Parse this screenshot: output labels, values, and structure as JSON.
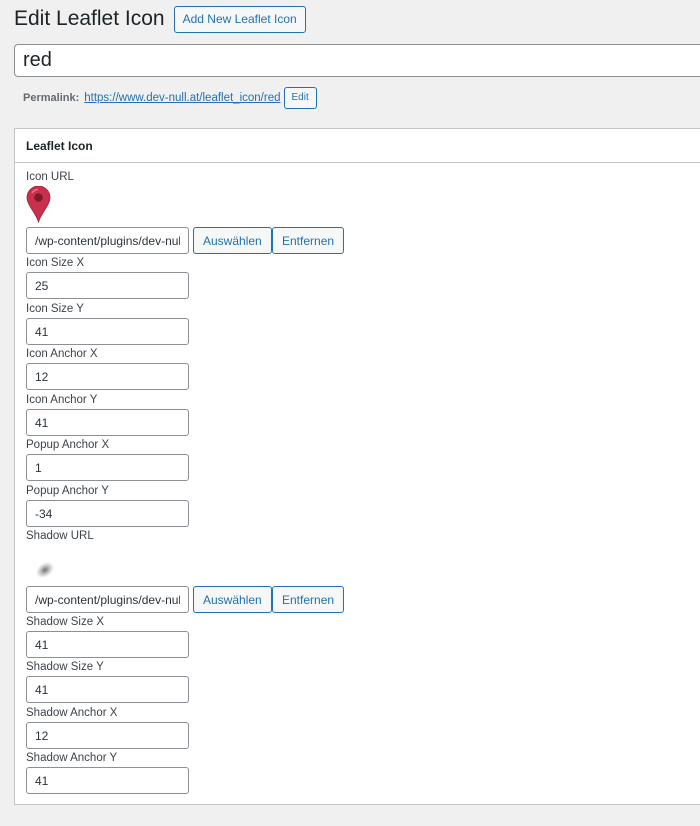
{
  "header": {
    "title": "Edit Leaflet Icon",
    "add_new_label": "Add New Leaflet Icon"
  },
  "post": {
    "title_value": "red",
    "permalink_label": "Permalink:",
    "permalink_url": "https://www.dev-null.at/leaflet_icon/red",
    "edit_label": "Edit"
  },
  "metabox": {
    "title": "Leaflet Icon",
    "icon_url": {
      "label": "Icon URL",
      "value": "/wp-content/plugins/dev-null-leaflet/icons/marker-icon-red.png",
      "select_label": "Auswählen",
      "remove_label": "Entfernen"
    },
    "icon_size_x": {
      "label": "Icon Size X",
      "value": "25"
    },
    "icon_size_y": {
      "label": "Icon Size Y",
      "value": "41"
    },
    "icon_anchor_x": {
      "label": "Icon Anchor X",
      "value": "12"
    },
    "icon_anchor_y": {
      "label": "Icon Anchor Y",
      "value": "41"
    },
    "popup_anchor_x": {
      "label": "Popup Anchor X",
      "value": "1"
    },
    "popup_anchor_y": {
      "label": "Popup Anchor Y",
      "value": "-34"
    },
    "shadow_url": {
      "label": "Shadow URL",
      "value": "/wp-content/plugins/dev-null-leaflet/icons/marker-shadow.png",
      "select_label": "Auswählen",
      "remove_label": "Entfernen"
    },
    "shadow_size_x": {
      "label": "Shadow Size X",
      "value": "41"
    },
    "shadow_size_y": {
      "label": "Shadow Size Y",
      "value": "41"
    },
    "shadow_anchor_x": {
      "label": "Shadow Anchor X",
      "value": "12"
    },
    "shadow_anchor_y": {
      "label": "Shadow Anchor Y",
      "value": "41"
    }
  },
  "icons": {
    "marker": "map-marker-icon",
    "shadow": "marker-shadow-icon"
  },
  "colors": {
    "accent": "#2271b1",
    "marker": "#c9304b"
  }
}
